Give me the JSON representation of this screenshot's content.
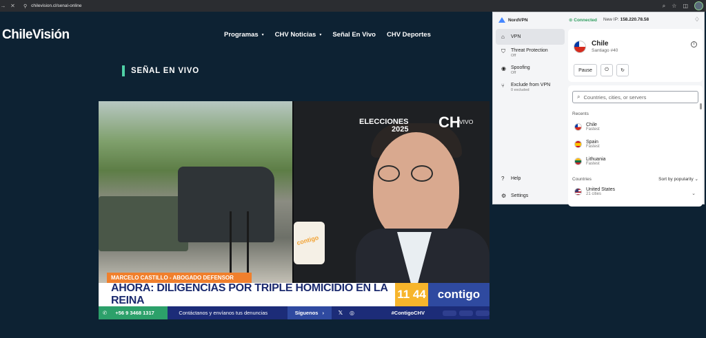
{
  "browser": {
    "url": "chilevision.cl/senal-online",
    "back_icon": "arrow-left",
    "close_icon": "x"
  },
  "site": {
    "logo": "ChileVisión",
    "nav": [
      {
        "label": "Programas",
        "has_caret": true
      },
      {
        "label": "CHV Noticias",
        "has_caret": true
      },
      {
        "label": "Señal En Vivo",
        "has_caret": false
      },
      {
        "label": "CHV Deportes",
        "has_caret": false
      }
    ],
    "section_title": "SEÑAL EN VIVO"
  },
  "video": {
    "overlay_event": "ELECCIONES",
    "overlay_year": "2025",
    "overlay_vivo": "VIVO",
    "mic_brand": "contigo",
    "name_lower_third": "MARCELO CASTILLO - ABOGADO DEFENSOR",
    "headline": "AHORA: DILIGENCIAS POR TRIPLE HOMICIDIO EN LA REINA",
    "clock": "11 44",
    "show_logo": "contigo",
    "ticker": {
      "phone": "+56 9 3468 1317",
      "message": "Contáctanos y envíanos tus denuncias",
      "follow": "Síguenos",
      "hashtag": "#ContigoCHV"
    }
  },
  "vpn": {
    "brand": "NordVPN",
    "status": "Connected",
    "ip_label": "New IP:",
    "ip_value": "158.220.78.58",
    "sidebar": [
      {
        "label": "VPN",
        "sub": "",
        "icon": "home",
        "active": true
      },
      {
        "label": "Threat Protection",
        "sub": "Off",
        "icon": "shield",
        "active": false
      },
      {
        "label": "Spoofing",
        "sub": "Off",
        "icon": "eye-off",
        "active": false
      },
      {
        "label": "Exclude from VPN",
        "sub": "0 excluded",
        "icon": "split",
        "active": false
      }
    ],
    "sidebar_bottom": [
      {
        "label": "Help",
        "icon": "help"
      },
      {
        "label": "Settings",
        "icon": "gear"
      }
    ],
    "current": {
      "country": "Chile",
      "server": "Santiago #40"
    },
    "pause_label": "Pause",
    "search_placeholder": "Countries, cities, or servers",
    "recents_label": "Recents",
    "recents": [
      {
        "name": "Chile",
        "sub": "Fastest",
        "flag": "chile"
      },
      {
        "name": "Spain",
        "sub": "Fastest",
        "flag": "spain"
      },
      {
        "name": "Lithuania",
        "sub": "Fastest",
        "flag": "lt"
      }
    ],
    "countries_label": "Countries",
    "sort_label": "Sort by popularity",
    "countries": [
      {
        "name": "United States",
        "sub": "21 cities",
        "flag": "us"
      }
    ]
  }
}
